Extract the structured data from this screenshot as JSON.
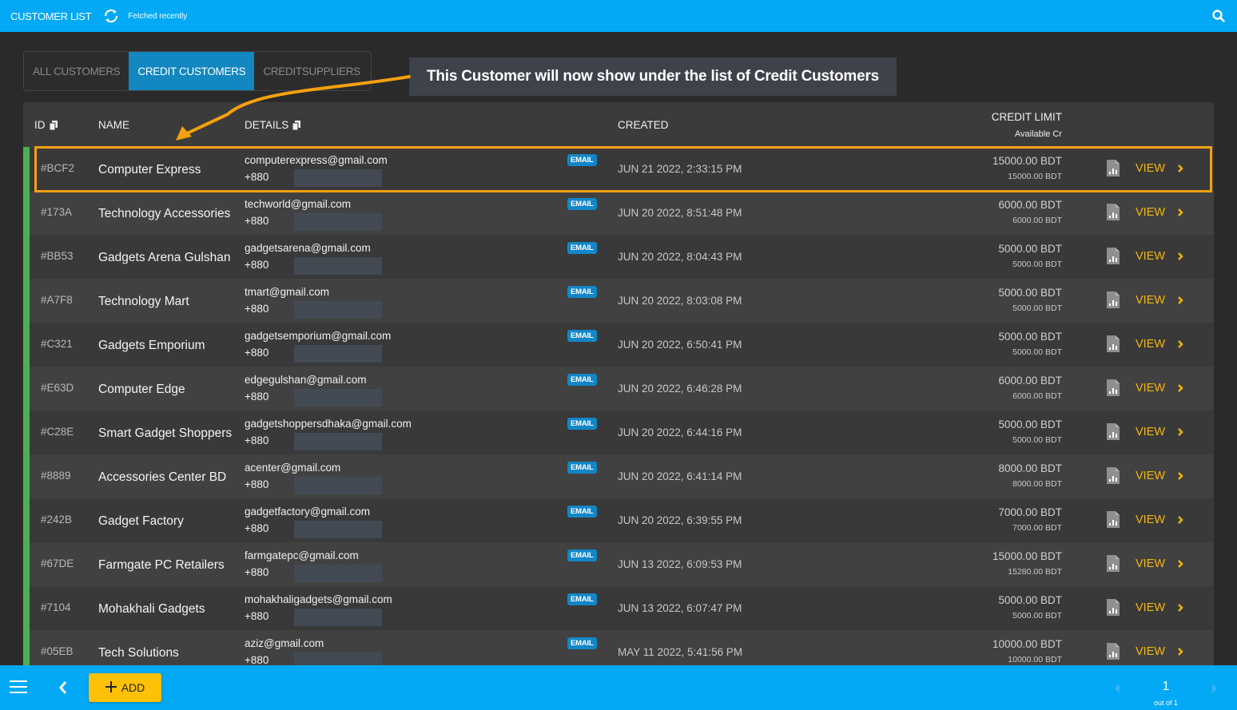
{
  "header": {
    "title": "CUSTOMER LIST",
    "status": "Fetched recently",
    "icons": {
      "sync": "sync-icon",
      "search": "search-icon"
    }
  },
  "tabs": [
    {
      "label": "ALL CUSTOMERS",
      "active": false
    },
    {
      "label": "CREDIT CUSTOMERS",
      "active": true
    },
    {
      "label": "CREDITSUPPLIERS",
      "active": false
    }
  ],
  "annotation": {
    "text": "This Customer will now show under the list of Credit Customers",
    "highlight_color": "#f5a10e"
  },
  "table": {
    "columns": {
      "id": "ID",
      "name": "NAME",
      "details": "DETAILS",
      "created": "CREATED",
      "credit_limit": "CREDIT LIMIT",
      "available": "Available Cr"
    },
    "badge_label": "EMAIL",
    "view_label": "VIEW",
    "rows": [
      {
        "id": "#BCF2",
        "name": "Computer Express",
        "email": "computerexpress@gmail.com",
        "phone": "+880",
        "created": "JUN 21 2022, 2:33:15 PM",
        "limit": "15000.00 BDT",
        "available": "15000.00 BDT",
        "highlighted": true
      },
      {
        "id": "#173A",
        "name": "Technology Accessories",
        "email": "techworld@gmail.com",
        "phone": "+880",
        "created": "JUN 20 2022, 8:51:48 PM",
        "limit": "6000.00 BDT",
        "available": "6000.00 BDT"
      },
      {
        "id": "#BB53",
        "name": "Gadgets Arena Gulshan",
        "email": "gadgetsarena@gmail.com",
        "phone": "+880",
        "created": "JUN 20 2022, 8:04:43 PM",
        "limit": "5000.00 BDT",
        "available": "5000.00 BDT"
      },
      {
        "id": "#A7F8",
        "name": "Technology Mart",
        "email": "tmart@gmail.com",
        "phone": "+880",
        "created": "JUN 20 2022, 8:03:08 PM",
        "limit": "5000.00 BDT",
        "available": "5000.00 BDT"
      },
      {
        "id": "#C321",
        "name": "Gadgets Emporium",
        "email": "gadgetsemporium@gmail.com",
        "phone": "+880",
        "created": "JUN 20 2022, 6:50:41 PM",
        "limit": "5000.00 BDT",
        "available": "5000.00 BDT"
      },
      {
        "id": "#E63D",
        "name": "Computer Edge",
        "email": "edgegulshan@gmail.com",
        "phone": "+880",
        "created": "JUN 20 2022, 6:46:28 PM",
        "limit": "6000.00 BDT",
        "available": "6000.00 BDT"
      },
      {
        "id": "#C28E",
        "name": "Smart Gadget Shoppers",
        "email": "gadgetshoppersdhaka@gmail.com",
        "phone": "+880",
        "created": "JUN 20 2022, 6:44:16 PM",
        "limit": "5000.00 BDT",
        "available": "5000.00 BDT"
      },
      {
        "id": "#8889",
        "name": "Accessories Center BD",
        "email": "acenter@gmail.com",
        "phone": "+880",
        "created": "JUN 20 2022, 6:41:14 PM",
        "limit": "8000.00 BDT",
        "available": "8000.00 BDT"
      },
      {
        "id": "#242B",
        "name": "Gadget Factory",
        "email": "gadgetfactory@gmail.com",
        "phone": "+880",
        "created": "JUN 20 2022, 6:39:55 PM",
        "limit": "7000.00 BDT",
        "available": "7000.00 BDT"
      },
      {
        "id": "#67DE",
        "name": "Farmgate PC Retailers",
        "email": "farmgatepc@gmail.com",
        "phone": "+880",
        "created": "JUN 13 2022, 6:09:53 PM",
        "limit": "15000.00 BDT",
        "available": "15280.00 BDT"
      },
      {
        "id": "#7104",
        "name": "Mohakhali Gadgets",
        "email": "mohakhaligadgets@gmail.com",
        "phone": "+880",
        "created": "JUN 13 2022, 6:07:47 PM",
        "limit": "5000.00 BDT",
        "available": "5000.00 BDT"
      },
      {
        "id": "#05EB",
        "name": "Tech Solutions",
        "email": "aziz@gmail.com",
        "phone": "+880",
        "created": "MAY 11 2022, 5:41:56 PM",
        "limit": "10000.00 BDT",
        "available": "10000.00 BDT"
      }
    ]
  },
  "footer": {
    "add_label": "ADD",
    "page": "1",
    "page_of": "out of 1"
  },
  "colors": {
    "primary": "#03a9f4",
    "tab_active": "#1287c0",
    "accent_bar": "#4caf50",
    "view": "#f5b50a",
    "add_button": "#ffc107"
  }
}
